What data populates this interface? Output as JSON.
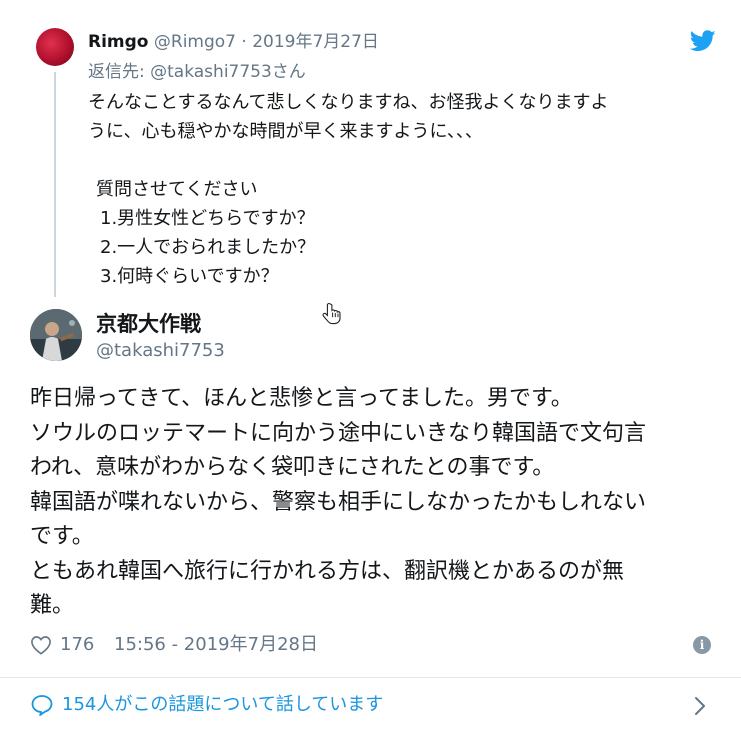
{
  "reply": {
    "name": "Rimgo",
    "handle": "@Rimgo7",
    "separator": "·",
    "date": "2019年7月27日",
    "reply_to_prefix": "返信先:",
    "reply_to_handle": "@takashi7753さん",
    "body_line1": "そんなことするなんて悲しくなりますね、お怪我よくなりますよ",
    "body_line2": "うに、心も穏やかな時間が早く来ますように、、、",
    "question_title": "質問させてください",
    "questions": [
      "1.男性女性どちらですか？",
      "2.一人でおられましたか？",
      "3.何時ぐらいですか？"
    ]
  },
  "main": {
    "name": "京都大作戦",
    "handle": "@takashi7753",
    "body_lines": [
      "昨日帰ってきて、ほんと悲惨と言ってました。男です。",
      "ソウルのロッテマートに向かう途中にいきなり韓国語で文句言",
      "われ、意味がわからなく袋叩きにされたとの事です。",
      "韓国語が喋れないから、警察も相手にしなかったかもしれない",
      "です。",
      "ともあれ韓国へ旅行に行かれる方は、翻訳機とかあるのが無",
      "難。"
    ],
    "likes": "176",
    "timestamp": "15:56 - 2019年7月28日"
  },
  "footer": {
    "conversation_text": "154人がこの話題について話しています"
  },
  "colors": {
    "link": "#1b95e0",
    "secondary": "#657786",
    "twitter_blue": "#1da1f2",
    "divider": "#e1e8ed"
  },
  "icons": [
    "twitter-bird-icon",
    "heart-icon",
    "info-icon",
    "speech-bubble-icon",
    "chevron-right-icon",
    "hand-cursor-icon"
  ]
}
